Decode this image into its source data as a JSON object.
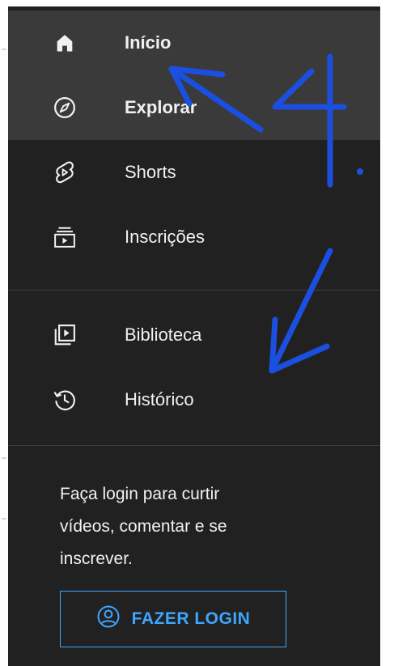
{
  "sidebar": {
    "items": [
      {
        "label": "Início",
        "icon": "home-icon",
        "active": true
      },
      {
        "label": "Explorar",
        "icon": "compass-icon",
        "active": true
      },
      {
        "label": "Shorts",
        "icon": "shorts-icon",
        "active": false
      },
      {
        "label": "Inscrições",
        "icon": "subscriptions-icon",
        "active": false
      }
    ],
    "library_items": [
      {
        "label": "Biblioteca",
        "icon": "library-icon"
      },
      {
        "label": "Histórico",
        "icon": "history-icon"
      }
    ],
    "login_prompt": {
      "line1": "Faça login para curtir",
      "line2": "vídeos, comentar e se",
      "line3": "inscrever."
    },
    "login_button": {
      "label": "FAZER LOGIN",
      "icon": "account-circle-icon"
    }
  },
  "colors": {
    "sidebar_bg": "#212121",
    "active_bg": "#3a3a3a",
    "text": "#f1f1f1",
    "accent": "#3ea6ff",
    "annotation": "#1a4fe0"
  }
}
